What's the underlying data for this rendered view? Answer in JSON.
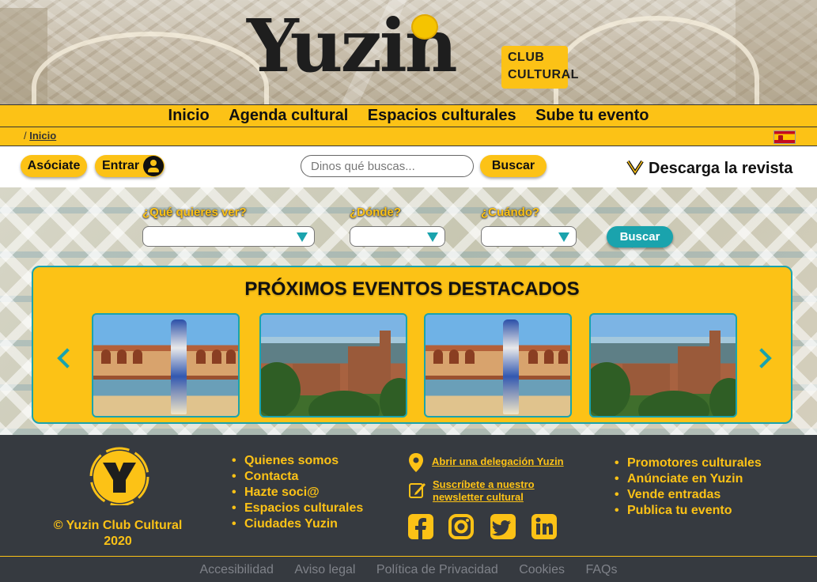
{
  "brand": {
    "logo_word": "Yuzin",
    "logo_tag": "CLUB CULTURAL"
  },
  "nav": {
    "items": [
      {
        "label": "Inicio"
      },
      {
        "label": "Agenda cultural"
      },
      {
        "label": "Espacios culturales"
      },
      {
        "label": "Sube tu evento"
      }
    ]
  },
  "breadcrumb": {
    "separator": "/",
    "current": "Inicio"
  },
  "language_flag": "spain-flag-icon",
  "toolbar": {
    "join_label": "Asóciate",
    "login_label": "Entrar",
    "search_placeholder": "Dinos qué buscas...",
    "search_button": "Buscar",
    "download_label": "Descarga la revista"
  },
  "filters": {
    "what_label": "¿Qué quieres ver?",
    "where_label": "¿Dónde?",
    "when_label": "¿Cuándo?",
    "search_button": "Buscar"
  },
  "featured": {
    "title": "PRÓXIMOS EVENTOS DESTACADOS",
    "cards": [
      {
        "image": "plaza-de-espana-image"
      },
      {
        "image": "alhambra-image"
      },
      {
        "image": "plaza-de-espana-image"
      },
      {
        "image": "alhambra-image"
      }
    ]
  },
  "footer": {
    "copyright_line1": "© Yuzin Club Cultural",
    "copyright_line2": "2020",
    "col1": [
      "Quienes somos",
      "Contacta",
      "Hazte soci@",
      "Espacios culturales",
      "Ciudades Yuzin"
    ],
    "delegation_link": "Abrir una delegación Yuzin",
    "newsletter_line1": "Suscríbete a nuestro",
    "newsletter_line2": "newsletter cultural",
    "social": [
      "facebook-icon",
      "instagram-icon",
      "twitter-icon",
      "linkedin-icon"
    ],
    "col3": [
      "Promotores culturales",
      "Anúnciate en Yuzin",
      "Vende entradas",
      "Publica tu evento"
    ],
    "legal": [
      "Accesibilidad",
      "Aviso legal",
      "Política de Privacidad",
      "Cookies",
      "FAQs"
    ]
  },
  "colors": {
    "brand_yellow": "#fcc216",
    "accent_teal": "#1aa3ad",
    "footer_bg": "#363a40",
    "text_dark": "#111111"
  }
}
